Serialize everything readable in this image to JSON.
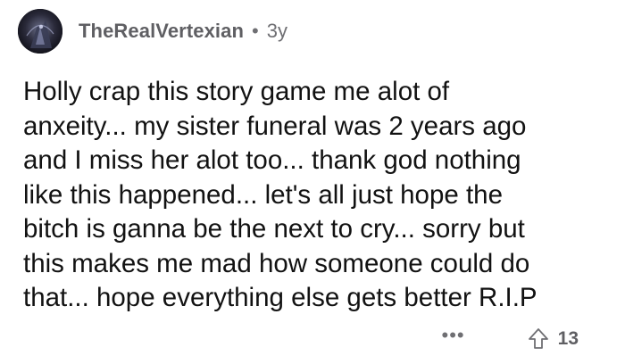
{
  "comment": {
    "username": "TheRealVertexian",
    "separator": "•",
    "age": "3y",
    "body_lines": [
      "Holly crap this story game me alot of",
      "anxeity... my sister funeral was 2 years ago",
      "and I miss her alot too... thank god nothing",
      "like this happened... let's all just hope the",
      "bitch is ganna be the next to cry... sorry but",
      "this makes me mad how someone could do",
      "that... hope everything else gets better R.I.P"
    ],
    "more_label": "•••",
    "upvote_icon": "upvote-arrow-icon",
    "score": "13"
  },
  "colors": {
    "text": "#121212",
    "muted": "#6f6f73",
    "username": "#5f5f63",
    "background": "#ffffff"
  }
}
